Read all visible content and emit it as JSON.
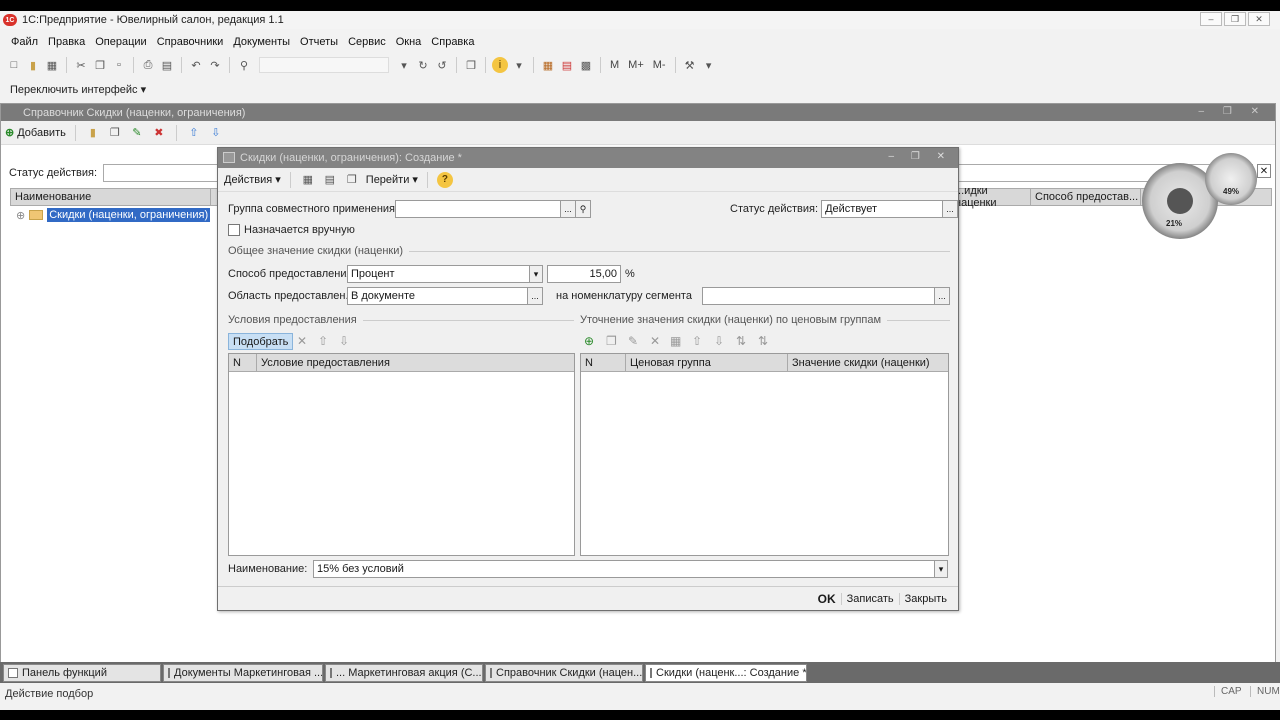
{
  "app": {
    "title": "1С:Предприятие - Ювелирный салон, редакция 1.1",
    "logo_text": "1С"
  },
  "menu": [
    "Файл",
    "Правка",
    "Операции",
    "Справочники",
    "Документы",
    "Отчеты",
    "Сервис",
    "Окна",
    "Справка"
  ],
  "toolbar": {
    "m_labels": [
      "M",
      "M+",
      "M-"
    ]
  },
  "switch_interface": "Переключить интерфейс",
  "bg_window": {
    "title": "Справочник Скидки (наценки, ограничения)",
    "add_label": "Добавить",
    "status_label": "Статус действия:",
    "col_name": "Наименование",
    "col_discount": "...идки наценки",
    "col_method": "Способ предостав...",
    "tree_item": "Скидки (наценки, ограничения)"
  },
  "dialog": {
    "title": "Скидки (наценки, ограничения): Создание *",
    "actions_label": "Действия",
    "goto_label": "Перейти",
    "group_label": "Группа совместного применения:",
    "group_value": "",
    "status_label": "Статус действия:",
    "status_value": "Действует",
    "manual_label": "Назначается вручную",
    "general_section": "Общее значение скидки (наценки)",
    "method_label": "Способ предоставления:",
    "method_value": "Процент",
    "amount_value": "15,00",
    "percent_sign": "%",
    "area_label": "Область предоставлен...",
    "area_value": "В документе",
    "nomenclature_label": "на номенклатуру сегмента",
    "conditions_section": "Условия предоставления",
    "refine_section": "Уточнение значения скидки (наценки) по ценовым группам",
    "pick_label": "Подобрать",
    "cond_col_n": "N",
    "cond_col_condition": "Условие предоставления",
    "price_col_n": "N",
    "price_col_group": "Ценовая группа",
    "price_col_value": "Значение скидки (наценки)",
    "name_label": "Наименование:",
    "name_value": "15% без условий",
    "ok_label": "OK",
    "save_label": "Записать",
    "close_label": "Закрыть"
  },
  "gauges": {
    "cpu": "21%",
    "mem": "49%"
  },
  "taskbar": [
    {
      "label": "Панель функций",
      "active": false
    },
    {
      "label": "Документы Маркетинговая ...",
      "active": false
    },
    {
      "label": "... Маркетинговая акция (С...",
      "active": false
    },
    {
      "label": "Справочник Скидки (нацен...",
      "active": false
    },
    {
      "label": "Скидки (наценк...: Создание *",
      "active": true
    }
  ],
  "status": {
    "text": "Действие подбор",
    "cap": "CAP",
    "num": "NUM"
  }
}
